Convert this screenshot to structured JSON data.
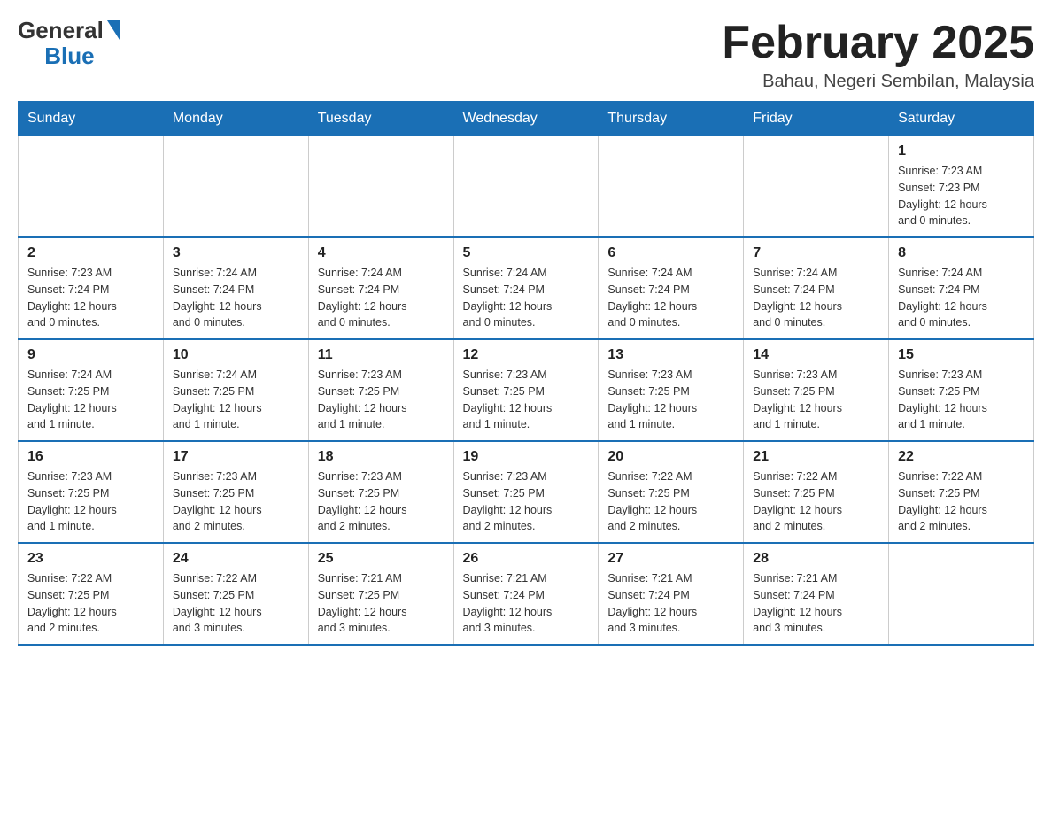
{
  "header": {
    "logo_general": "General",
    "logo_blue": "Blue",
    "title": "February 2025",
    "subtitle": "Bahau, Negeri Sembilan, Malaysia"
  },
  "calendar": {
    "days_of_week": [
      "Sunday",
      "Monday",
      "Tuesday",
      "Wednesday",
      "Thursday",
      "Friday",
      "Saturday"
    ],
    "weeks": [
      [
        {
          "day": "",
          "info": ""
        },
        {
          "day": "",
          "info": ""
        },
        {
          "day": "",
          "info": ""
        },
        {
          "day": "",
          "info": ""
        },
        {
          "day": "",
          "info": ""
        },
        {
          "day": "",
          "info": ""
        },
        {
          "day": "1",
          "info": "Sunrise: 7:23 AM\nSunset: 7:23 PM\nDaylight: 12 hours\nand 0 minutes."
        }
      ],
      [
        {
          "day": "2",
          "info": "Sunrise: 7:23 AM\nSunset: 7:24 PM\nDaylight: 12 hours\nand 0 minutes."
        },
        {
          "day": "3",
          "info": "Sunrise: 7:24 AM\nSunset: 7:24 PM\nDaylight: 12 hours\nand 0 minutes."
        },
        {
          "day": "4",
          "info": "Sunrise: 7:24 AM\nSunset: 7:24 PM\nDaylight: 12 hours\nand 0 minutes."
        },
        {
          "day": "5",
          "info": "Sunrise: 7:24 AM\nSunset: 7:24 PM\nDaylight: 12 hours\nand 0 minutes."
        },
        {
          "day": "6",
          "info": "Sunrise: 7:24 AM\nSunset: 7:24 PM\nDaylight: 12 hours\nand 0 minutes."
        },
        {
          "day": "7",
          "info": "Sunrise: 7:24 AM\nSunset: 7:24 PM\nDaylight: 12 hours\nand 0 minutes."
        },
        {
          "day": "8",
          "info": "Sunrise: 7:24 AM\nSunset: 7:24 PM\nDaylight: 12 hours\nand 0 minutes."
        }
      ],
      [
        {
          "day": "9",
          "info": "Sunrise: 7:24 AM\nSunset: 7:25 PM\nDaylight: 12 hours\nand 1 minute."
        },
        {
          "day": "10",
          "info": "Sunrise: 7:24 AM\nSunset: 7:25 PM\nDaylight: 12 hours\nand 1 minute."
        },
        {
          "day": "11",
          "info": "Sunrise: 7:23 AM\nSunset: 7:25 PM\nDaylight: 12 hours\nand 1 minute."
        },
        {
          "day": "12",
          "info": "Sunrise: 7:23 AM\nSunset: 7:25 PM\nDaylight: 12 hours\nand 1 minute."
        },
        {
          "day": "13",
          "info": "Sunrise: 7:23 AM\nSunset: 7:25 PM\nDaylight: 12 hours\nand 1 minute."
        },
        {
          "day": "14",
          "info": "Sunrise: 7:23 AM\nSunset: 7:25 PM\nDaylight: 12 hours\nand 1 minute."
        },
        {
          "day": "15",
          "info": "Sunrise: 7:23 AM\nSunset: 7:25 PM\nDaylight: 12 hours\nand 1 minute."
        }
      ],
      [
        {
          "day": "16",
          "info": "Sunrise: 7:23 AM\nSunset: 7:25 PM\nDaylight: 12 hours\nand 1 minute."
        },
        {
          "day": "17",
          "info": "Sunrise: 7:23 AM\nSunset: 7:25 PM\nDaylight: 12 hours\nand 2 minutes."
        },
        {
          "day": "18",
          "info": "Sunrise: 7:23 AM\nSunset: 7:25 PM\nDaylight: 12 hours\nand 2 minutes."
        },
        {
          "day": "19",
          "info": "Sunrise: 7:23 AM\nSunset: 7:25 PM\nDaylight: 12 hours\nand 2 minutes."
        },
        {
          "day": "20",
          "info": "Sunrise: 7:22 AM\nSunset: 7:25 PM\nDaylight: 12 hours\nand 2 minutes."
        },
        {
          "day": "21",
          "info": "Sunrise: 7:22 AM\nSunset: 7:25 PM\nDaylight: 12 hours\nand 2 minutes."
        },
        {
          "day": "22",
          "info": "Sunrise: 7:22 AM\nSunset: 7:25 PM\nDaylight: 12 hours\nand 2 minutes."
        }
      ],
      [
        {
          "day": "23",
          "info": "Sunrise: 7:22 AM\nSunset: 7:25 PM\nDaylight: 12 hours\nand 2 minutes."
        },
        {
          "day": "24",
          "info": "Sunrise: 7:22 AM\nSunset: 7:25 PM\nDaylight: 12 hours\nand 3 minutes."
        },
        {
          "day": "25",
          "info": "Sunrise: 7:21 AM\nSunset: 7:25 PM\nDaylight: 12 hours\nand 3 minutes."
        },
        {
          "day": "26",
          "info": "Sunrise: 7:21 AM\nSunset: 7:24 PM\nDaylight: 12 hours\nand 3 minutes."
        },
        {
          "day": "27",
          "info": "Sunrise: 7:21 AM\nSunset: 7:24 PM\nDaylight: 12 hours\nand 3 minutes."
        },
        {
          "day": "28",
          "info": "Sunrise: 7:21 AM\nSunset: 7:24 PM\nDaylight: 12 hours\nand 3 minutes."
        },
        {
          "day": "",
          "info": ""
        }
      ]
    ]
  }
}
